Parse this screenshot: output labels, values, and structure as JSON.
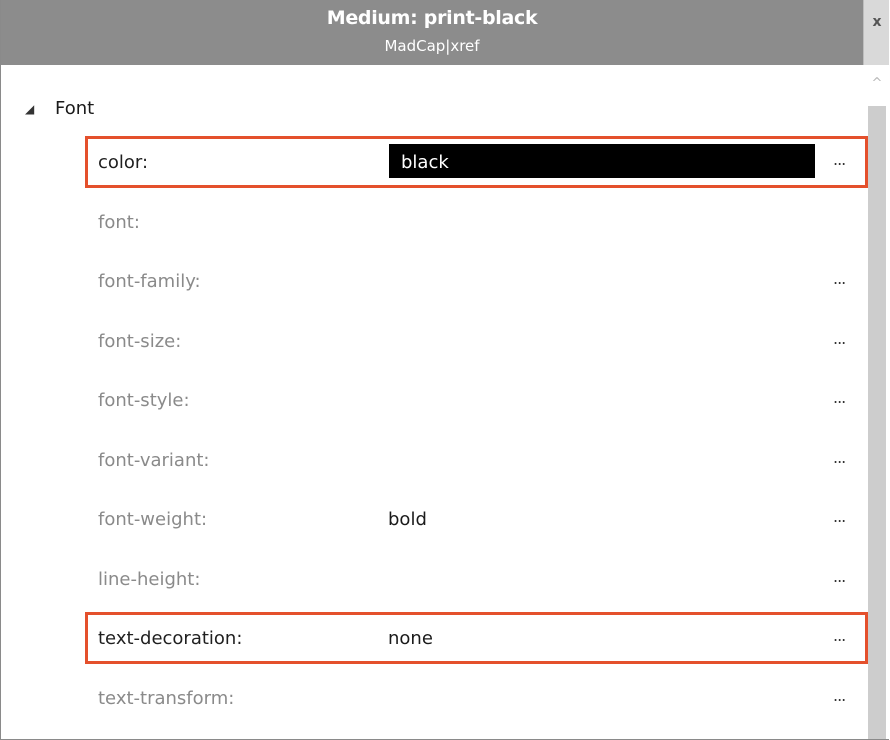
{
  "header": {
    "title": "Medium: print-black",
    "subtitle": "MadCap|xref",
    "close_glyph": "x"
  },
  "category": {
    "expander_glyph": "◢",
    "label": "Font"
  },
  "properties": [
    {
      "label": "color:",
      "value": "black",
      "set": true,
      "highlighted": true,
      "value_box": true,
      "ellipsis": "..."
    },
    {
      "label": "font:",
      "value": "",
      "set": false,
      "highlighted": false,
      "ellipsis": ""
    },
    {
      "label": "font-family:",
      "value": "",
      "set": false,
      "highlighted": false,
      "ellipsis": "..."
    },
    {
      "label": "font-size:",
      "value": "",
      "set": false,
      "highlighted": false,
      "ellipsis": "..."
    },
    {
      "label": "font-style:",
      "value": "",
      "set": false,
      "highlighted": false,
      "ellipsis": "..."
    },
    {
      "label": "font-variant:",
      "value": "",
      "set": false,
      "highlighted": false,
      "ellipsis": "..."
    },
    {
      "label": "font-weight:",
      "value": "bold",
      "set": false,
      "highlighted": false,
      "ellipsis": "..."
    },
    {
      "label": "line-height:",
      "value": "",
      "set": false,
      "highlighted": false,
      "ellipsis": "..."
    },
    {
      "label": "text-decoration:",
      "value": "none",
      "set": true,
      "highlighted": true,
      "ellipsis": "..."
    },
    {
      "label": "text-transform:",
      "value": "",
      "set": false,
      "highlighted": false,
      "ellipsis": "..."
    }
  ],
  "colors": {
    "header_bg": "#8c8c8c",
    "highlight": "#e4502c",
    "value_box": "#000000"
  },
  "scrollbar": {
    "up_glyph": "^"
  }
}
